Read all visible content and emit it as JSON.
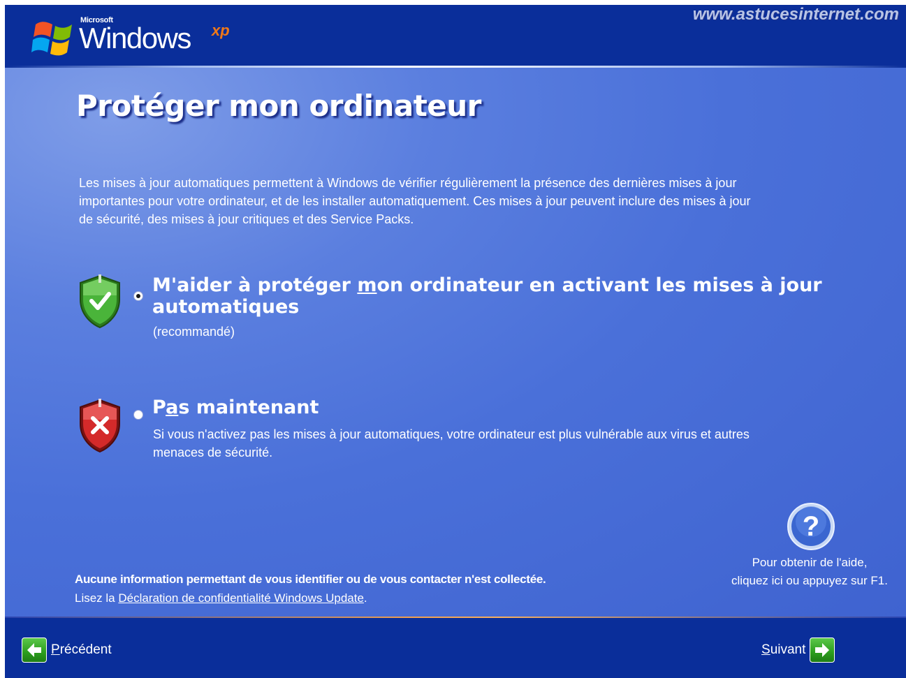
{
  "header": {
    "brand_company": "Microsoft",
    "brand_product": "Windows",
    "brand_edition": "xp",
    "watermark": "www.astucesinternet.com"
  },
  "page": {
    "title": "Protéger mon ordinateur",
    "intro_lines": [
      "Les mises à jour automatiques permettent à Windows de vérifier régulièrement la présence des dernières mises à jour",
      "importantes pour votre ordinateur, et de les installer automatiquement. Ces mises à jour peuvent inclure des mises à jour",
      "de sécurité, des mises à jour critiques et des Service Packs."
    ]
  },
  "options": [
    {
      "label_line1_pre": "M'aider à protéger ",
      "label_line1_accel": "m",
      "label_line1_post": "on ordinateur en activant les mises à jour",
      "label_line2": "automatiques",
      "sub_lines": [
        "(recommandé)"
      ],
      "selected": true,
      "icon": "shield-check-icon"
    },
    {
      "label_pre": "P",
      "label_accel": "a",
      "label_post": "s maintenant",
      "sub_lines": [
        "Si vous n'activez pas les mises à jour automatiques, votre ordinateur est plus vulnérable aux virus et autres",
        "menaces de sécurité."
      ],
      "selected": false,
      "icon": "shield-x-icon"
    }
  ],
  "help": {
    "icon": "question-mark-icon",
    "line1": "Pour obtenir de l'aide,",
    "line2": "cliquez ici ou appuyez sur F1."
  },
  "privacy": {
    "notice": "Aucune information permettant de vous identifier ou de vous contacter n'est collectée.",
    "prefix": "Lisez la ",
    "link": "Déclaration de confidentialité Windows Update",
    "suffix": "."
  },
  "nav": {
    "back_accel": "P",
    "back_rest": "récédent",
    "next_accel": "S",
    "next_rest": "uivant"
  },
  "colors": {
    "bar_blue": "#0a2e9a",
    "panel_blue": "#4a70d9",
    "accent_orange": "#f0a050",
    "button_green": "#2c9e1e"
  }
}
